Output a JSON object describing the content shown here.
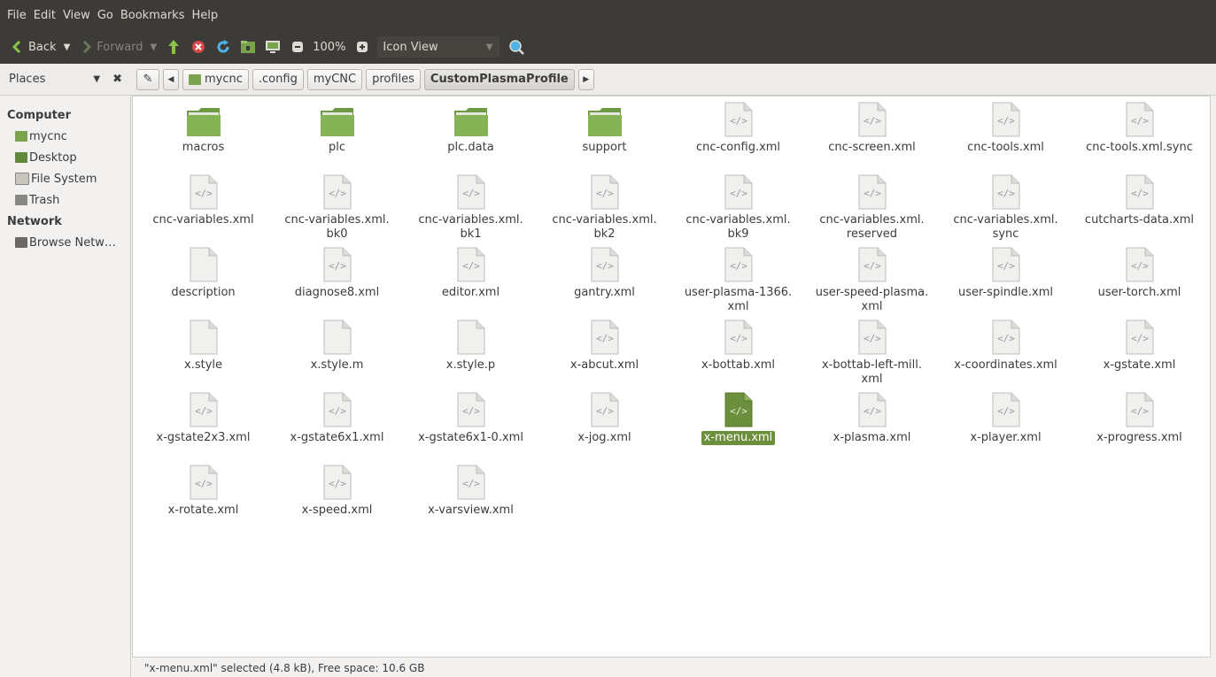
{
  "menubar": {
    "items": [
      "File",
      "Edit",
      "View",
      "Go",
      "Bookmarks",
      "Help"
    ]
  },
  "toolbar": {
    "back_label": "Back",
    "forward_label": "Forward",
    "zoom_label": "100%",
    "view_label": "Icon View"
  },
  "location": {
    "places_label": "Places",
    "crumbs": [
      "mycnc",
      ".config",
      "myCNC",
      "profiles",
      "CustomPlasmaProfile"
    ]
  },
  "sidebar": {
    "computer_heading": "Computer",
    "computer_items": [
      "mycnc",
      "Desktop",
      "File System",
      "Trash"
    ],
    "network_heading": "Network",
    "network_items": [
      "Browse Netw…"
    ]
  },
  "files": [
    {
      "name": "macros",
      "type": "folder"
    },
    {
      "name": "plc",
      "type": "folder"
    },
    {
      "name": "plc.data",
      "type": "folder"
    },
    {
      "name": "support",
      "type": "folder"
    },
    {
      "name": "cnc-config.xml",
      "type": "xml"
    },
    {
      "name": "cnc-screen.xml",
      "type": "xml"
    },
    {
      "name": "cnc-tools.xml",
      "type": "xml"
    },
    {
      "name": "cnc-tools.xml.sync",
      "type": "xml"
    },
    {
      "name": "cnc-variables.xml",
      "type": "xml"
    },
    {
      "name": "cnc-variables.xml.\nbk0",
      "type": "xml"
    },
    {
      "name": "cnc-variables.xml.\nbk1",
      "type": "xml"
    },
    {
      "name": "cnc-variables.xml.\nbk2",
      "type": "xml"
    },
    {
      "name": "cnc-variables.xml.\nbk9",
      "type": "xml"
    },
    {
      "name": "cnc-variables.xml.\nreserved",
      "type": "xml"
    },
    {
      "name": "cnc-variables.xml.\nsync",
      "type": "xml"
    },
    {
      "name": "cutcharts-data.xml",
      "type": "xml"
    },
    {
      "name": "description",
      "type": "text"
    },
    {
      "name": "diagnose8.xml",
      "type": "xml"
    },
    {
      "name": "editor.xml",
      "type": "xml"
    },
    {
      "name": "gantry.xml",
      "type": "xml"
    },
    {
      "name": "user-plasma-1366.\nxml",
      "type": "xml"
    },
    {
      "name": "user-speed-plasma.\nxml",
      "type": "xml"
    },
    {
      "name": "user-spindle.xml",
      "type": "xml"
    },
    {
      "name": "user-torch.xml",
      "type": "xml"
    },
    {
      "name": "x.style",
      "type": "text"
    },
    {
      "name": "x.style.m",
      "type": "text"
    },
    {
      "name": "x.style.p",
      "type": "text"
    },
    {
      "name": "x-abcut.xml",
      "type": "xml"
    },
    {
      "name": "x-bottab.xml",
      "type": "xml"
    },
    {
      "name": "x-bottab-left-mill.\nxml",
      "type": "xml"
    },
    {
      "name": "x-coordinates.xml",
      "type": "xml"
    },
    {
      "name": "x-gstate.xml",
      "type": "xml"
    },
    {
      "name": "x-gstate2x3.xml",
      "type": "xml"
    },
    {
      "name": "x-gstate6x1.xml",
      "type": "xml"
    },
    {
      "name": "x-gstate6x1-0.xml",
      "type": "xml"
    },
    {
      "name": "x-jog.xml",
      "type": "xml"
    },
    {
      "name": "x-menu.xml",
      "type": "xml",
      "selected": true
    },
    {
      "name": "x-plasma.xml",
      "type": "xml"
    },
    {
      "name": "x-player.xml",
      "type": "xml"
    },
    {
      "name": "x-progress.xml",
      "type": "xml"
    },
    {
      "name": "x-rotate.xml",
      "type": "xml"
    },
    {
      "name": "x-speed.xml",
      "type": "xml"
    },
    {
      "name": "x-varsview.xml",
      "type": "xml"
    }
  ],
  "status": {
    "text": "\"x-menu.xml\" selected (4.8 kB), Free space: 10.6 GB"
  },
  "colors": {
    "accent": "#6c8f3d",
    "folder": "#7aa34e",
    "toolbar_bg": "#3c3b37"
  }
}
